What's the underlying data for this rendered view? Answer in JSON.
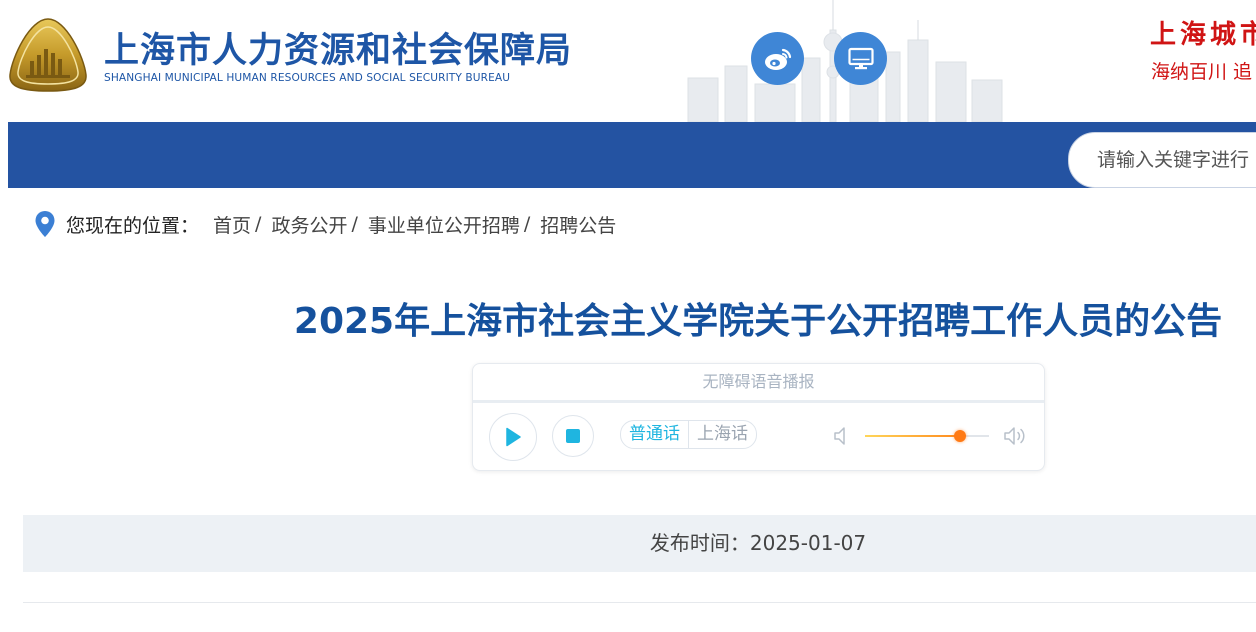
{
  "header": {
    "site_title_cn": "上海市人力资源和社会保障局",
    "site_title_en": "SHANGHAI MUNICIPAL HUMAN RESOURCES AND SOCIAL SECURITY BUREAU",
    "slogan_line1": "上海城市",
    "slogan_line2": "海纳百川  追",
    "weibo_icon": "weibo-icon",
    "pc_icon": "desktop-icon"
  },
  "search": {
    "placeholder": "请输入关键字进行"
  },
  "breadcrumb": {
    "prefix": "您现在的位置：",
    "items": [
      "首页",
      "政务公开",
      "事业单位公开招聘",
      "招聘公告"
    ],
    "separator": "/"
  },
  "article": {
    "title": "2025年上海市社会主义学院关于公开招聘工作人员的公告",
    "publish_label": "发布时间：2025-01-07"
  },
  "audio_player": {
    "caption": "无障碍语音播报",
    "dialects": [
      "普通话",
      "上海话"
    ],
    "active_dialect": "普通话",
    "volume": 0.77
  },
  "colors": {
    "brand_blue": "#2453a2",
    "title_blue": "#15519d",
    "slogan_red": "#d01414",
    "accent_cyan": "#1fb5e0"
  }
}
